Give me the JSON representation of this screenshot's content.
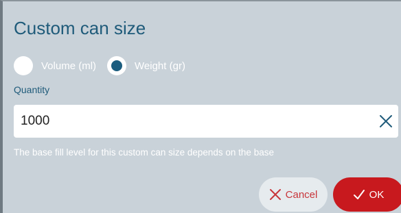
{
  "dialog": {
    "title": "Custom can size",
    "radios": [
      {
        "label": "Volume (ml)",
        "selected": false
      },
      {
        "label": "Weight (gr)",
        "selected": true
      }
    ],
    "quantity_label": "Quantity",
    "quantity_value": "1000",
    "hint": "The base fill level for this custom can size depends on the base",
    "cancel_label": "Cancel",
    "ok_label": "OK",
    "cancel_icon": "close-icon",
    "ok_icon": "check-icon",
    "clear_icon": "clear-icon"
  },
  "colors": {
    "background": "#c9d2d9",
    "accent": "#1b5d7f",
    "title": "#1f5b7a",
    "ok_button": "#c8191e",
    "cancel_button_bg": "#e6ebee",
    "cancel_text": "#c8353a"
  }
}
